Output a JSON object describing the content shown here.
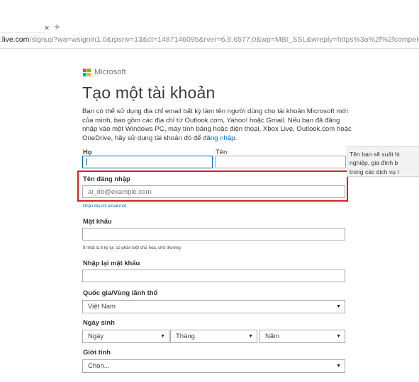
{
  "browser": {
    "tab_close": "×",
    "new_tab": "+",
    "url_host": ".live.com",
    "url_rest": "/signup?wa=wsignin1.0&rpsnv=13&ct=1487146095&rver=6.6.6577.0&wp=MBI_SSL&wreply=https%3a%2f%2fcompete.i"
  },
  "brand": {
    "name": "Microsoft",
    "colors": [
      "#f25022",
      "#7fba00",
      "#00a4ef",
      "#ffb900"
    ]
  },
  "page": {
    "title": "Tạo một tài khoản",
    "intro_1": "Bạn có thể sử dụng địa chỉ email bất kỳ làm tên người dùng cho tài khoản Microsoft mới của mình, bao gồm các địa chỉ từ Outlook.com, Yahoo! hoặc Gmail. Nếu bạn đã đăng nhập vào một Windows PC, máy tính bảng hoặc điện thoại, Xbox Live, Outlook.com hoặc OneDrive, hãy sử dụng tài khoản đó để ",
    "intro_link": "đăng nhập",
    "intro_end": "."
  },
  "form": {
    "last_name_label": "Họ",
    "first_name_label": "Tên",
    "last_name_value": "",
    "first_name_value": "",
    "username_label": "Tên đăng nhập",
    "username_placeholder": "ai_do@example.com",
    "new_email_link": "Nhận địa chỉ email mới",
    "password_label": "Mật khẩu",
    "password_hint": "Ít nhất là 8 ký tự; có phân biệt chữ hoa, chữ thường",
    "reenter_password_label": "Nhập lại mật khẩu",
    "country_label": "Quốc gia/Vùng lãnh thổ",
    "country_value": "Việt Nam",
    "birthdate_label": "Ngày sinh",
    "day_value": "Ngày",
    "month_value": "Tháng",
    "year_value": "Năm",
    "gender_label": "Giới tính",
    "gender_value": "Chọn...",
    "dropdown_arrow": "▼"
  },
  "tooltip": {
    "line1": "Tên bạn sẽ xuất hi",
    "line2": "nghiệp, gia đình b",
    "line3": "trong các dịch vụ I"
  }
}
